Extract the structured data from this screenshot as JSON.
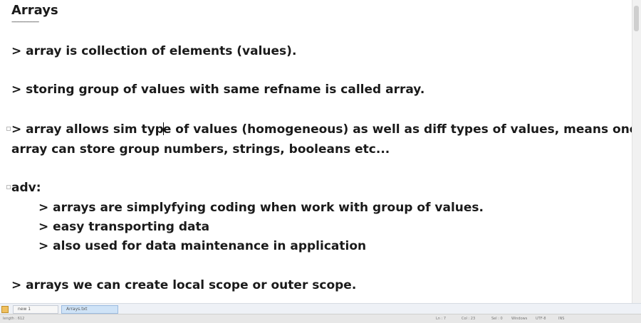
{
  "document": {
    "heading": "Arrays",
    "heading_underline": "-----------------",
    "line1": "> array is collection of elements (values).",
    "line2": "> storing group of values with same refname is called array.",
    "line3a_before_cursor": "> array allows sim typ",
    "line3a_after_cursor": "e of values (homogeneous) as well as diff types of values, means one",
    "line3b": "array can store group numbers, strings, booleans etc...",
    "adv_label": "adv:",
    "adv_items": [
      "> arrays are simplyfying coding when work with group of values.",
      "> easy transporting data",
      "> also used for data maintenance in application"
    ],
    "line5": "> arrays we can create local scope or outer scope."
  },
  "tabs": [
    {
      "label": "new 1"
    },
    {
      "label": "Arrays.txt"
    }
  ],
  "statusbar": {
    "left_text": "length : 612",
    "cells": [
      "Ln : 7",
      "Col : 23",
      "Sel : 0",
      "Windows",
      "UTF-8",
      "INS"
    ]
  }
}
